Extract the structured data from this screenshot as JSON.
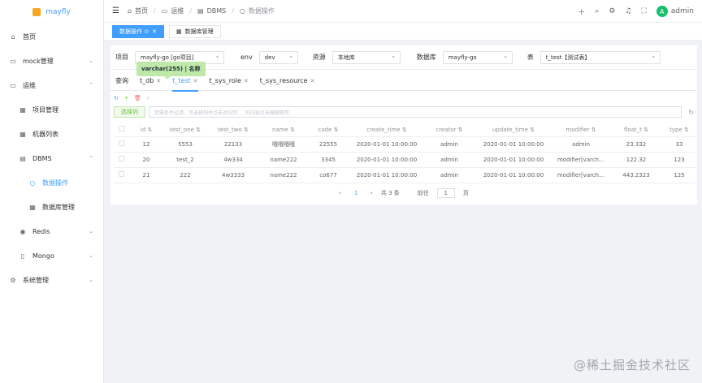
{
  "logo": {
    "text": "mayfly"
  },
  "sidebar": {
    "items": [
      {
        "label": "首页",
        "icon": "home-icon"
      },
      {
        "label": "mock管理",
        "icon": "monitor-icon"
      },
      {
        "label": "运维",
        "icon": "monitor-icon"
      },
      {
        "label": "项目管理",
        "icon": "grid-icon"
      },
      {
        "label": "机器列表",
        "icon": "grid-icon"
      },
      {
        "label": "DBMS",
        "icon": "table-icon"
      },
      {
        "label": "数据操作",
        "icon": "circle-icon"
      },
      {
        "label": "数据库管理",
        "icon": "grid-icon"
      },
      {
        "label": "Redis",
        "icon": "redis-icon"
      },
      {
        "label": "Mongo",
        "icon": "doc-icon"
      },
      {
        "label": "系统管理",
        "icon": "gear-icon"
      }
    ]
  },
  "header": {
    "breadcrumb": [
      "首页",
      "运维",
      "DBMS",
      "数据操作"
    ],
    "user": "admin",
    "avatar_letter": "A"
  },
  "tagsview": {
    "tags": [
      "数据操作 ⊙",
      "数据库管理"
    ]
  },
  "filters": {
    "project_label": "项目",
    "project_value": "mayfly-go [go项目]",
    "env_label": "env",
    "env_value": "dev",
    "resource_label": "资源",
    "resource_value": "本地库",
    "db_label": "数据库",
    "db_value": "mayfly-go",
    "table_label": "表",
    "table_value": "t_test【测试表】"
  },
  "tabs": {
    "query": "查询",
    "items": [
      "t_db",
      "t_test",
      "t_sys_role",
      "t_sys_resource"
    ]
  },
  "condition": {
    "select_col": "选择列",
    "placeholder": "若需条件过滤，可选择列并点击对应列 … 的内容点击编辑即可"
  },
  "tooltip": "varchar(255) | 名称",
  "table": {
    "columns": [
      "id",
      "test_one",
      "test_two",
      "name",
      "code",
      "create_time",
      "creator",
      "update_time",
      "modifier",
      "float_t",
      "type"
    ],
    "rows": [
      [
        "12",
        "5553",
        "22133",
        "哦哦哦哦",
        "22555",
        "2020-01-01 10:00:00",
        "admin",
        "2020-01-01 10:00:00",
        "admin",
        "23.332",
        "33"
      ],
      [
        "20",
        "test_2",
        "4w334",
        "name222",
        "3345",
        "2020-01-01 10:00:00",
        "admin",
        "2020-01-01 10:00:00",
        "modifier[varch…",
        "122.32",
        "123"
      ],
      [
        "21",
        "222",
        "4w3333",
        "name222",
        "co677",
        "2020-01-01 10:00:00",
        "admin",
        "2020-01-01 10:00:00",
        "modifier[varch…",
        "443.2323",
        "125"
      ]
    ]
  },
  "pager": {
    "page": "1",
    "total": "共 3 条",
    "goto_label": "前往",
    "goto_value": "1",
    "page_unit": "页"
  },
  "watermark": "@稀土掘金技术社区"
}
